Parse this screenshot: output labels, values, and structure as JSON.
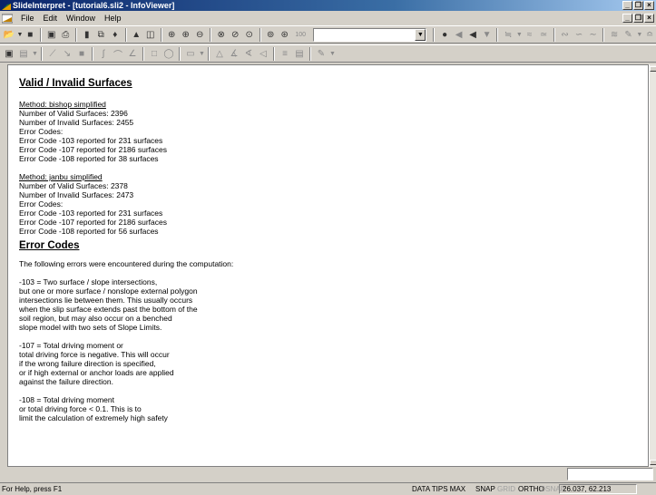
{
  "window": {
    "title": "SlideInterpret - [tutorial6.sli2 - InfoViewer]",
    "buttons": [
      "_",
      "❒",
      "×"
    ]
  },
  "menu": {
    "items": [
      "File",
      "Edit",
      "Window",
      "Help"
    ]
  },
  "toolbar": {
    "zoom_value": "100",
    "combo_value": ""
  },
  "document": {
    "section1_title": "Valid / Invalid Surfaces",
    "methods": [
      {
        "name": "Method: bishop simplified",
        "lines": [
          "Number of Valid Surfaces: 2396",
          "Number of Invalid Surfaces: 2455",
          "Error Codes:",
          "Error Code -103 reported for 231 surfaces",
          "Error Code -107 reported for 2186 surfaces",
          "Error Code -108 reported for 38 surfaces"
        ]
      },
      {
        "name": "Method: janbu simplified",
        "lines": [
          "Number of Valid Surfaces: 2378",
          "Number of Invalid Surfaces: 2473",
          "Error Codes:",
          "Error Code -103 reported for 231 surfaces",
          "Error Code -107 reported for 2186 surfaces",
          "Error Code -108 reported for 56 surfaces"
        ]
      }
    ],
    "section2_title": "Error Codes",
    "intro": "The following errors were encountered during the computation:",
    "codes": [
      [
        "-103 = Two surface / slope intersections,",
        "but one or more surface / nonslope external polygon",
        "intersections lie between them. This usually occurs",
        "when the slip surface extends past the bottom of the",
        "soil region, but may also occur on a benched",
        "slope model with two sets of Slope Limits."
      ],
      [
        "-107 = Total driving moment or",
        "total driving force is negative. This will occur",
        "if the wrong failure direction is specified,",
        "or if high external or anchor loads are applied",
        "against the failure direction."
      ],
      [
        "-108 = Total driving moment",
        "or total driving force < 0.1. This is to",
        "limit the calculation of extremely high safety"
      ]
    ]
  },
  "status": {
    "help": "For Help, press F1",
    "data_tips": "DATA TIPS MAX",
    "snap": "SNAP",
    "grid": "GRID",
    "ortho": "ORTHO",
    "osnap": "OSNAP",
    "coords": "26.037, 62.213"
  },
  "colors": {
    "titlebar_start": "#0a246a",
    "titlebar_end": "#a6caf0",
    "chrome": "#d4d0c8"
  }
}
